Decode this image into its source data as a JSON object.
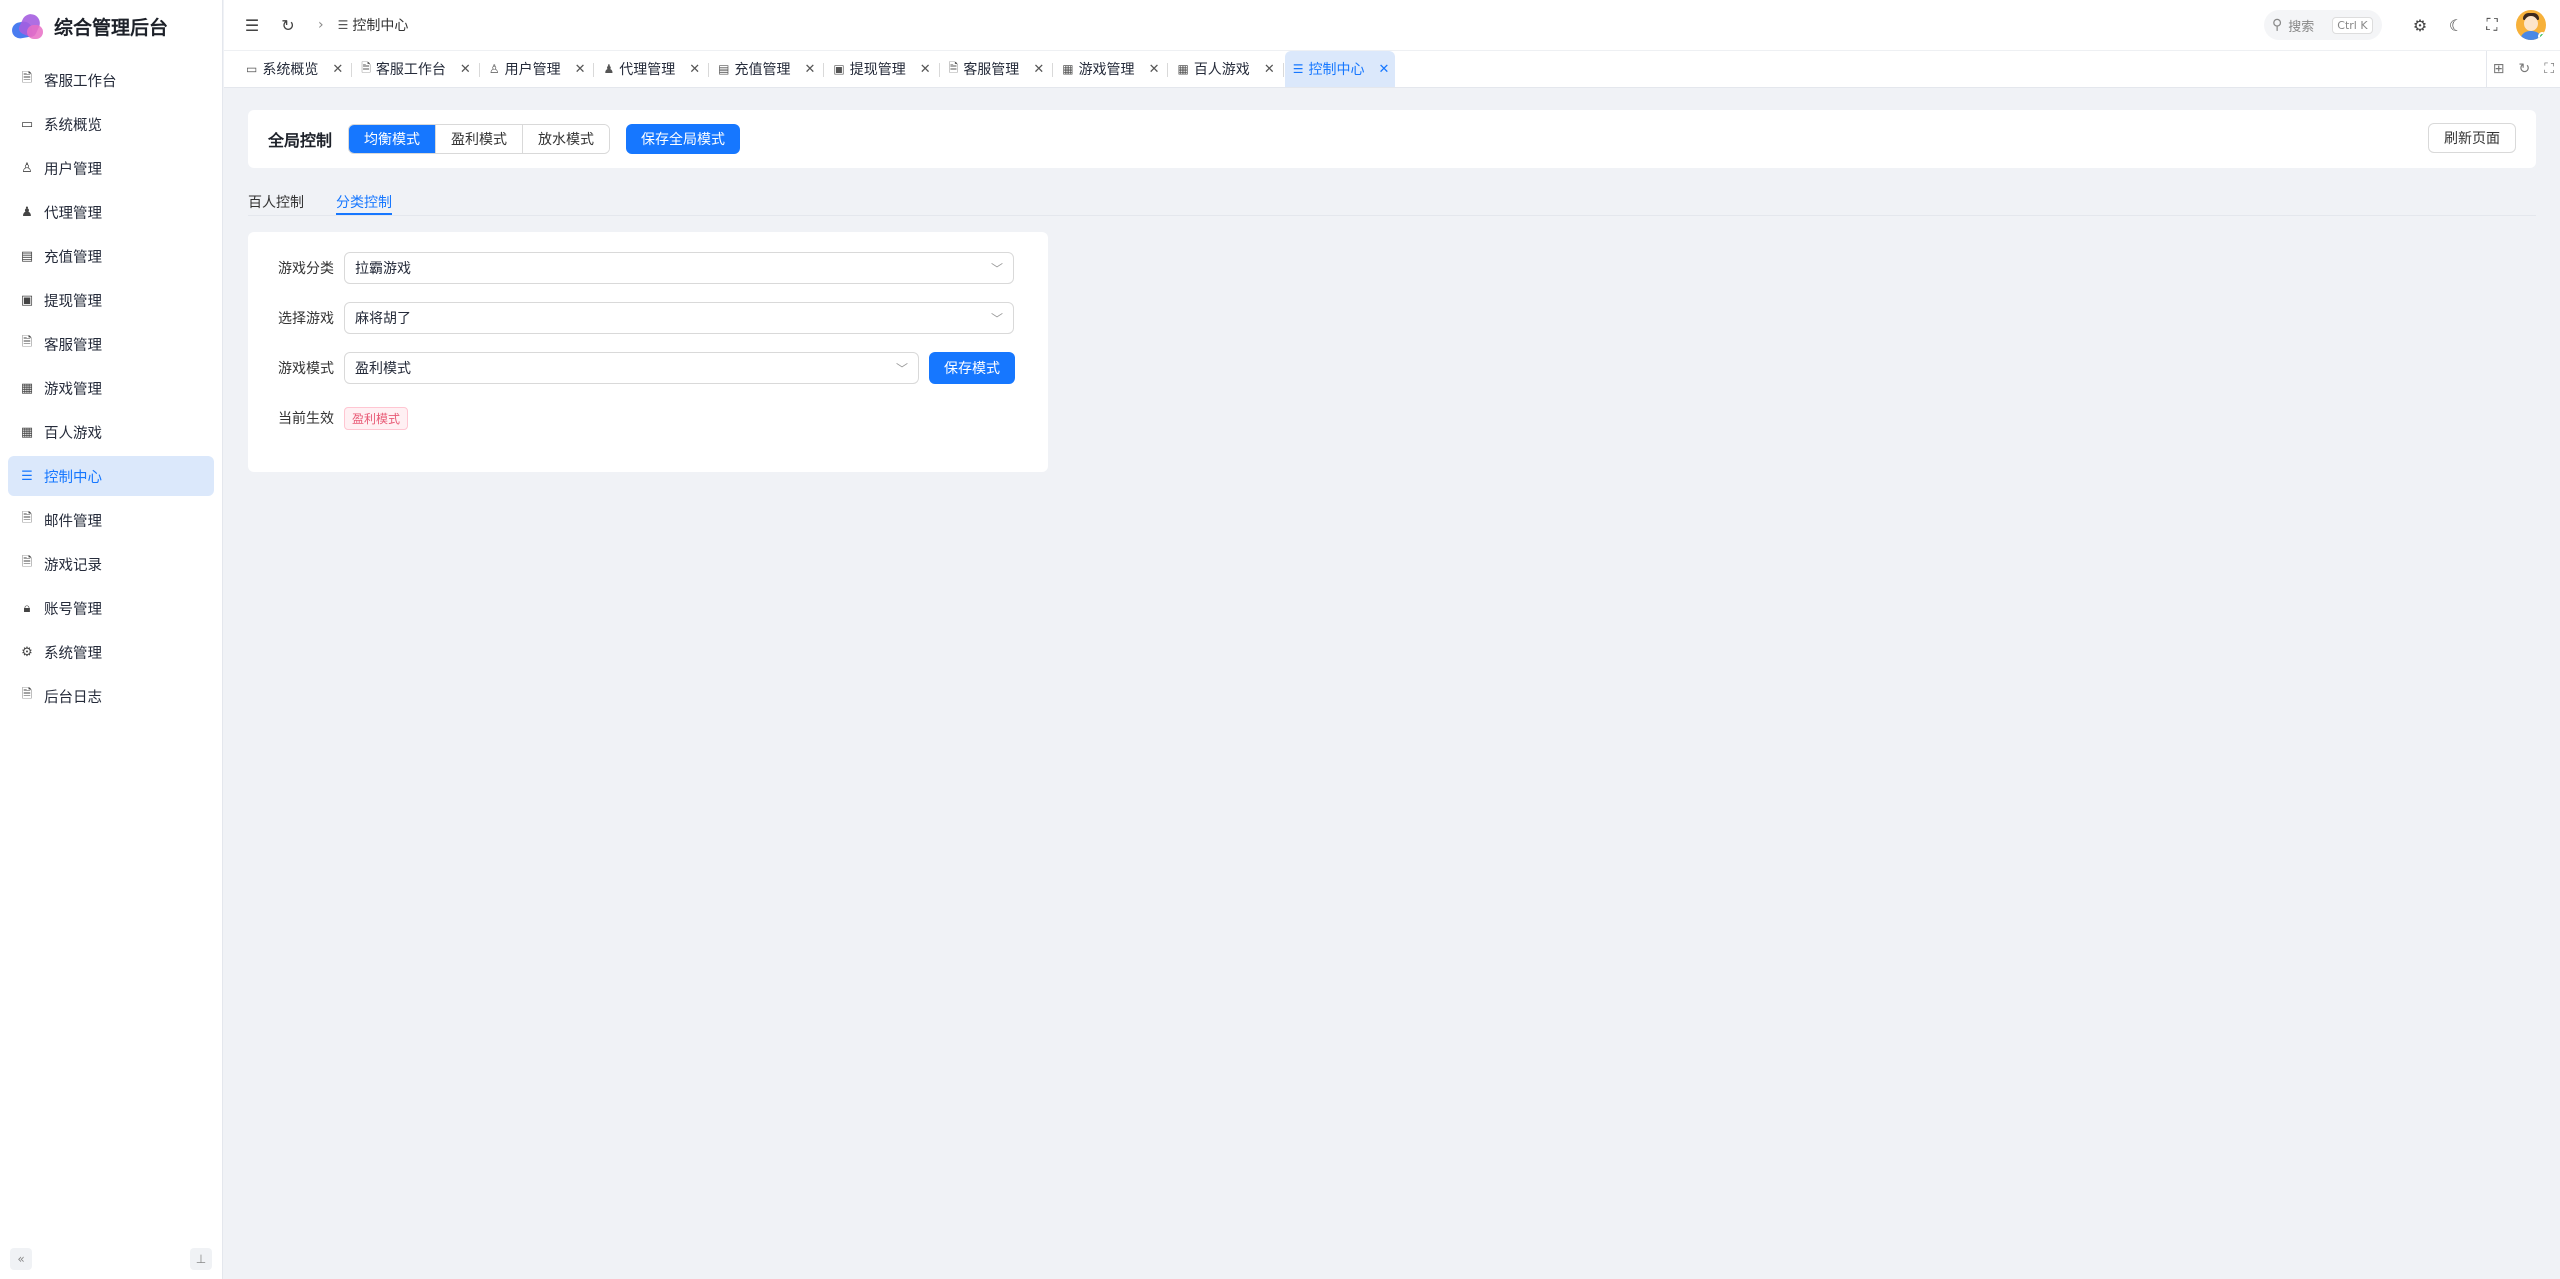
{
  "app": {
    "title": "综合管理后台"
  },
  "sidebar": {
    "items": [
      {
        "label": "客服工作台",
        "icon": "document-icon"
      },
      {
        "label": "系统概览",
        "icon": "monitor-icon"
      },
      {
        "label": "用户管理",
        "icon": "user-icon"
      },
      {
        "label": "代理管理",
        "icon": "user-filled-icon"
      },
      {
        "label": "充值管理",
        "icon": "card-icon"
      },
      {
        "label": "提现管理",
        "icon": "wallet-icon"
      },
      {
        "label": "客服管理",
        "icon": "document-icon"
      },
      {
        "label": "游戏管理",
        "icon": "grid-icon"
      },
      {
        "label": "百人游戏",
        "icon": "grid-icon"
      },
      {
        "label": "控制中心",
        "icon": "sliders-icon",
        "active": true
      },
      {
        "label": "邮件管理",
        "icon": "document-icon"
      },
      {
        "label": "游戏记录",
        "icon": "document-icon"
      },
      {
        "label": "账号管理",
        "icon": "lock-icon"
      },
      {
        "label": "系统管理",
        "icon": "gear-icon"
      },
      {
        "label": "后台日志",
        "icon": "document-icon"
      }
    ]
  },
  "header": {
    "breadcrumb": "控制中心",
    "search_placeholder": "搜索",
    "search_shortcut": "Ctrl K"
  },
  "tabs": [
    {
      "label": "系统概览"
    },
    {
      "label": "客服工作台"
    },
    {
      "label": "用户管理"
    },
    {
      "label": "代理管理"
    },
    {
      "label": "充值管理"
    },
    {
      "label": "提现管理"
    },
    {
      "label": "客服管理"
    },
    {
      "label": "游戏管理"
    },
    {
      "label": "百人游戏"
    },
    {
      "label": "控制中心",
      "active": true
    }
  ],
  "global_control": {
    "title": "全局控制",
    "modes": [
      "均衡模式",
      "盈利模式",
      "放水模式"
    ],
    "selected_mode": "均衡模式",
    "save_label": "保存全局模式",
    "refresh_label": "刷新页面"
  },
  "subtabs": [
    "百人控制",
    "分类控制"
  ],
  "active_subtab": "分类控制",
  "form": {
    "category_label": "游戏分类",
    "category_value": "拉霸游戏",
    "game_label": "选择游戏",
    "game_value": "麻将胡了",
    "mode_label": "游戏模式",
    "mode_value": "盈利模式",
    "save_mode_label": "保存模式",
    "current_label": "当前生效",
    "current_value": "盈利模式"
  },
  "colors": {
    "primary": "#1677ff",
    "active_bg": "#dbe8fb",
    "tag_text": "#e85a76"
  }
}
